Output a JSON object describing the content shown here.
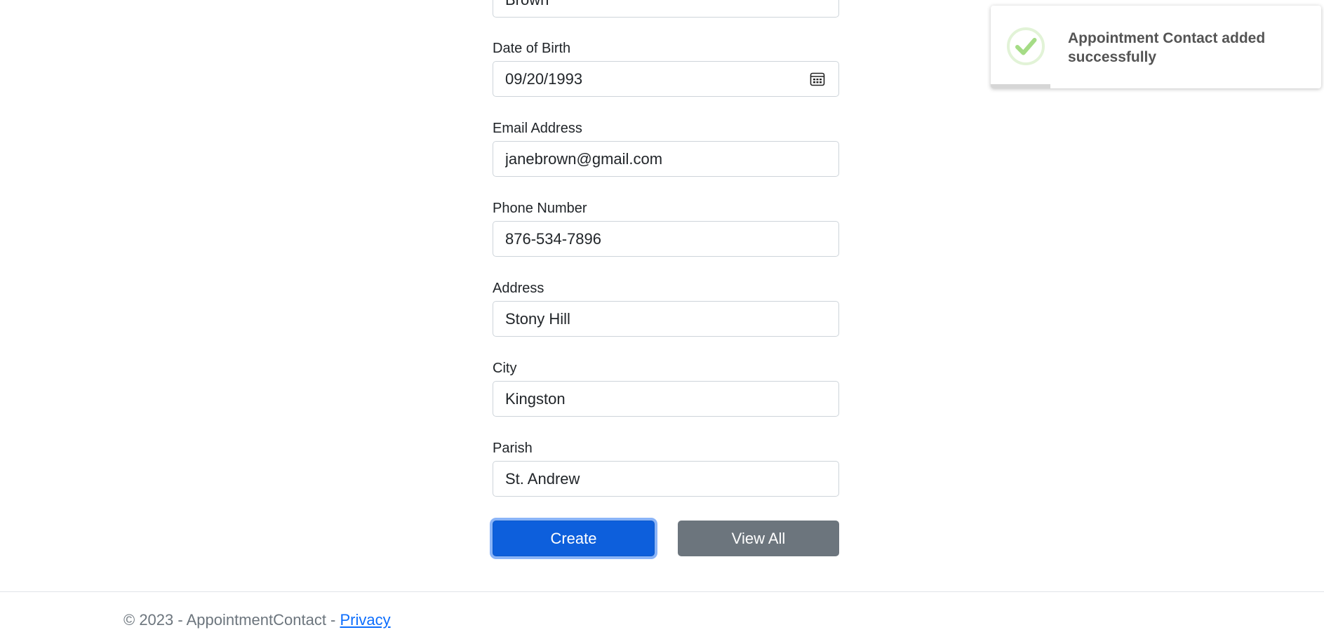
{
  "form": {
    "last_name": {
      "value": "Brown"
    },
    "dob": {
      "label": "Date of Birth",
      "value": "09/20/1993",
      "icon": "calendar-icon"
    },
    "email": {
      "label": "Email Address",
      "value": "janebrown@gmail.com"
    },
    "phone": {
      "label": "Phone Number",
      "value": "876-534-7896"
    },
    "address": {
      "label": "Address",
      "value": "Stony Hill"
    },
    "city": {
      "label": "City",
      "value": "Kingston"
    },
    "parish": {
      "label": "Parish",
      "value": "St. Andrew"
    },
    "create_label": "Create",
    "view_all_label": "View All"
  },
  "footer": {
    "copyright": "© 2023 - AppointmentContact - ",
    "privacy_label": "Privacy"
  },
  "toast": {
    "message": "Appointment Contact added successfully",
    "icon": "check-circle-icon",
    "success_color": "#a5dc86",
    "progress_fraction": 0.18
  },
  "colors": {
    "primary": "#0d5fdc",
    "secondary": "#6c757d",
    "link": "#0d6efd"
  }
}
